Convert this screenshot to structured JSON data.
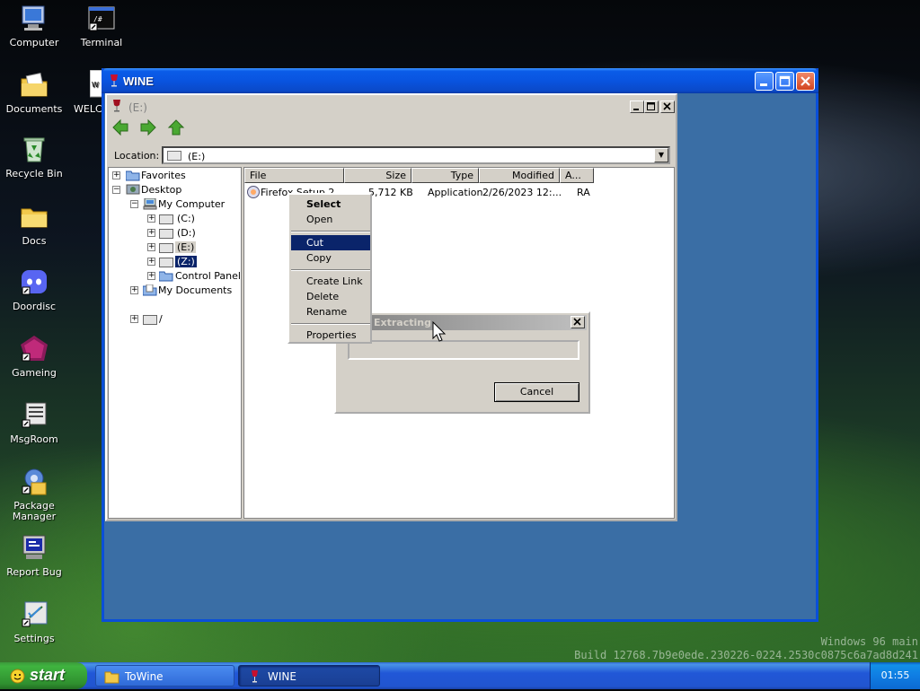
{
  "desktop": {
    "icons": [
      {
        "label": "Computer"
      },
      {
        "label": "Terminal"
      },
      {
        "label": "Documents"
      },
      {
        "label": "WELCO"
      },
      {
        "label": "Recycle Bin"
      },
      {
        "label": "Docs"
      },
      {
        "label": "Doordisc"
      },
      {
        "label": "Gameing"
      },
      {
        "label": "MsgRoom"
      },
      {
        "label": "Package Manager"
      },
      {
        "label": "Report Bug"
      },
      {
        "label": "Settings"
      }
    ],
    "watermark_line1": "Windows 96 main",
    "watermark_line2": "Build 12768.7b9e0ede.230226-0224.2530c0875c6a7ad8d241"
  },
  "wine_window": {
    "title": "WINE",
    "minimize_icon": "minimize-icon",
    "maximize_icon": "maximize-icon",
    "close_icon": "close-icon"
  },
  "explorer": {
    "title": "(E:)",
    "location_label": "Location:",
    "location_value": "(E:)",
    "tree": {
      "favorites": "Favorites",
      "desktop": "Desktop",
      "my_computer": "My Computer",
      "drive_c": "(C:)",
      "drive_d": "(D:)",
      "drive_e": "(E:)",
      "drive_z": "(Z:)",
      "control_panel": "Control Panel",
      "my_documents": "My Documents",
      "root": "/"
    },
    "columns": [
      "File",
      "Size",
      "Type",
      "Modified",
      "A..."
    ],
    "files": [
      {
        "name": "Firefox Setup 2...",
        "size": "5,712 KB",
        "type": "Application",
        "modified": "2/26/2023 12:...",
        "attr": "RA"
      }
    ]
  },
  "context_menu": {
    "items": [
      {
        "label": "Select",
        "bold": true
      },
      {
        "label": "Open"
      },
      {
        "label": "Cut",
        "highlighted": true
      },
      {
        "label": "Copy"
      },
      {
        "label": "Create Link"
      },
      {
        "label": "Delete"
      },
      {
        "label": "Rename"
      },
      {
        "label": "Properties"
      }
    ]
  },
  "dialog": {
    "title": "Extracting",
    "progress": 0,
    "cancel_label": "Cancel"
  },
  "taskbar": {
    "start_label": "start",
    "buttons": [
      {
        "label": "ToWine",
        "icon": "folder-icon"
      },
      {
        "label": "WINE",
        "icon": "wine-glass-icon",
        "active": true
      }
    ],
    "clock": "01:55"
  },
  "colors": {
    "xp_blue": "#0a5ce8",
    "menu_highlight": "#0a246a",
    "classic_face": "#d4d0c8"
  }
}
